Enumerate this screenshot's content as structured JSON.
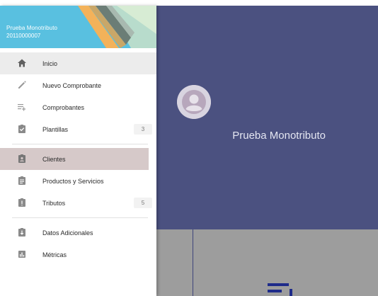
{
  "profile": {
    "name": "Prueba Monotributo",
    "cuit": "20110000007"
  },
  "background": {
    "user_name": "Prueba Monotributo"
  },
  "menu": {
    "group1": [
      {
        "label": "Inicio",
        "icon": "home-icon",
        "count": ""
      },
      {
        "label": "Nuevo Comprobante",
        "icon": "pencil-icon",
        "count": ""
      },
      {
        "label": "Comprobantes",
        "icon": "list-add-icon",
        "count": ""
      },
      {
        "label": "Plantillas",
        "icon": "clipboard-check-icon",
        "count": "3"
      }
    ],
    "group2": [
      {
        "label": "Clientes",
        "icon": "contact-badge-icon",
        "count": ""
      },
      {
        "label": "Productos y Servicios",
        "icon": "clipboard-list-icon",
        "count": ""
      },
      {
        "label": "Tributos",
        "icon": "clipboard-alert-icon",
        "count": "5"
      }
    ],
    "group3": [
      {
        "label": "Datos Adicionales",
        "icon": "clipboard-download-icon",
        "count": ""
      },
      {
        "label": "Métricas",
        "icon": "bar-chart-icon",
        "count": ""
      }
    ]
  },
  "colors": {
    "header_bg": "#4b5180",
    "drawer_header": "#59c0e0",
    "active_item": "#d6c9c9",
    "icon_gray": "#8a8a8a"
  }
}
